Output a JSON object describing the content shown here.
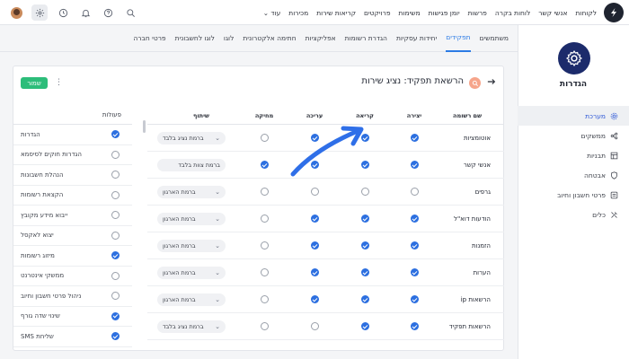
{
  "topnav": {
    "items": [
      "לקוחות",
      "אנשי קשר",
      "לוחות בקרה",
      "פרשות",
      "יומן פגישות",
      "משימות",
      "פרויקטים",
      "קריאות שירות",
      "מכירות",
      "עוד"
    ]
  },
  "sidebar": {
    "title": "הגדרות",
    "items": [
      {
        "label": "מערכת",
        "active": true
      },
      {
        "label": "ממשקים",
        "active": false
      },
      {
        "label": "תבניות",
        "active": false
      },
      {
        "label": "אבטחה",
        "active": false
      },
      {
        "label": "פרטי חשבון וחיוב",
        "active": false
      },
      {
        "label": "כלים",
        "active": false
      }
    ]
  },
  "tabs": [
    {
      "label": "משתמשים",
      "active": false
    },
    {
      "label": "תפקידים",
      "active": true
    },
    {
      "label": "יחידות עסקיות",
      "active": false
    },
    {
      "label": "הגדרת רשומות",
      "active": false
    },
    {
      "label": "אפליקציות",
      "active": false
    },
    {
      "label": "חתימה אלקטרונית",
      "active": false
    },
    {
      "label": "לוגו",
      "active": false
    },
    {
      "label": "לוגו לחשבונית",
      "active": false
    },
    {
      "label": "פרטי חברה",
      "active": false
    }
  ],
  "card": {
    "title": "הרשאת תפקיד: נציג שירות",
    "save_label": "שמור"
  },
  "actions": {
    "header": "פעולות",
    "items": [
      {
        "label": "הגדרות",
        "on": true
      },
      {
        "label": "הגדרות חוקים לסיסמא",
        "on": false
      },
      {
        "label": "הנהלת חשבונות",
        "on": false
      },
      {
        "label": "הקצאת רשומות",
        "on": false
      },
      {
        "label": "ייבוא מידע מקובץ",
        "on": false
      },
      {
        "label": "יצוא לאקסל",
        "on": false
      },
      {
        "label": "מיזוג רשומות",
        "on": true
      },
      {
        "label": "ממשקי אינטרנט",
        "on": false
      },
      {
        "label": "ניהול פרטי חשבון וחיוב",
        "on": false
      },
      {
        "label": "שינוי שדה גורף",
        "on": true
      },
      {
        "label": "שליחת SMS",
        "on": true
      }
    ]
  },
  "table": {
    "headers": {
      "name": "שם רשומה",
      "create": "יצירה",
      "read": "קריאה",
      "edit": "עריכה",
      "delete": "מחיקה",
      "share": "שיתוף"
    },
    "rows": [
      {
        "name": "אוטומציות",
        "create": true,
        "read": true,
        "edit": true,
        "delete": false,
        "share": "ברמת נציג בלבד",
        "chev": true
      },
      {
        "name": "אנשי קשר",
        "create": true,
        "read": true,
        "edit": true,
        "delete": true,
        "share": "ברמת צוות בלבד",
        "chev": false
      },
      {
        "name": "גרפים",
        "create": false,
        "read": false,
        "edit": false,
        "delete": false,
        "share": "ברמת הארגון",
        "chev": true
      },
      {
        "name": "הודעות דוא\"ל",
        "create": true,
        "read": true,
        "edit": true,
        "delete": false,
        "share": "ברמת הארגון",
        "chev": true
      },
      {
        "name": "הזמנות",
        "create": true,
        "read": true,
        "edit": true,
        "delete": false,
        "share": "ברמת הארגון",
        "chev": true
      },
      {
        "name": "הערות",
        "create": true,
        "read": true,
        "edit": true,
        "delete": false,
        "share": "ברמת הארגון",
        "chev": true
      },
      {
        "name": "הרשאות ip",
        "create": true,
        "read": true,
        "edit": true,
        "delete": false,
        "share": "ברמת הארגון",
        "chev": true
      },
      {
        "name": "הרשאות תפקיד",
        "create": true,
        "read": true,
        "edit": false,
        "delete": false,
        "share": "ברמת נציג בלבד",
        "chev": true
      }
    ]
  },
  "colors": {
    "accent": "#2c6fe0",
    "save": "#2dbd7a",
    "sidebar_icon": "#1c2b6b",
    "tab_active": "#2c7be5",
    "annotation_arrow": "#2f6fe8"
  }
}
